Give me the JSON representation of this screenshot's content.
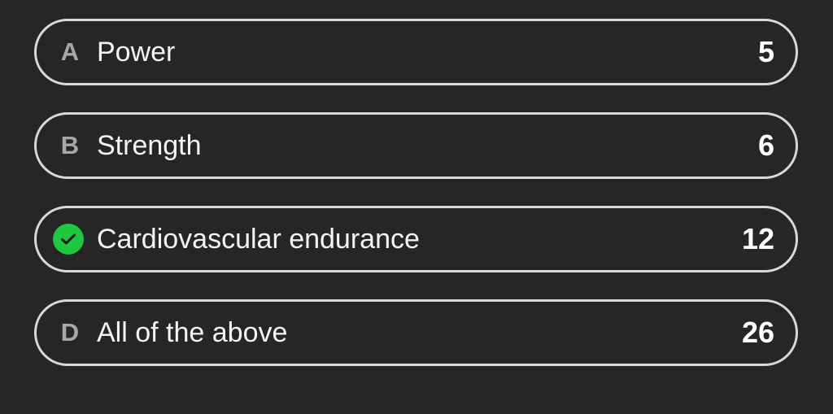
{
  "options": [
    {
      "letter": "A",
      "label": "Power",
      "count": "5"
    },
    {
      "letter": "B",
      "label": "Strength",
      "count": "6"
    },
    {
      "letter": "C",
      "label": "Cardiovascular endurance",
      "count": "12",
      "correct": true,
      "marker_icon": "check-circle-icon"
    },
    {
      "letter": "D",
      "label": "All of the above",
      "count": "26"
    }
  ],
  "colors": {
    "background": "#262626",
    "border": "#d9d9d9",
    "correct": "#1fc741",
    "letter": "#a7a7a7"
  }
}
